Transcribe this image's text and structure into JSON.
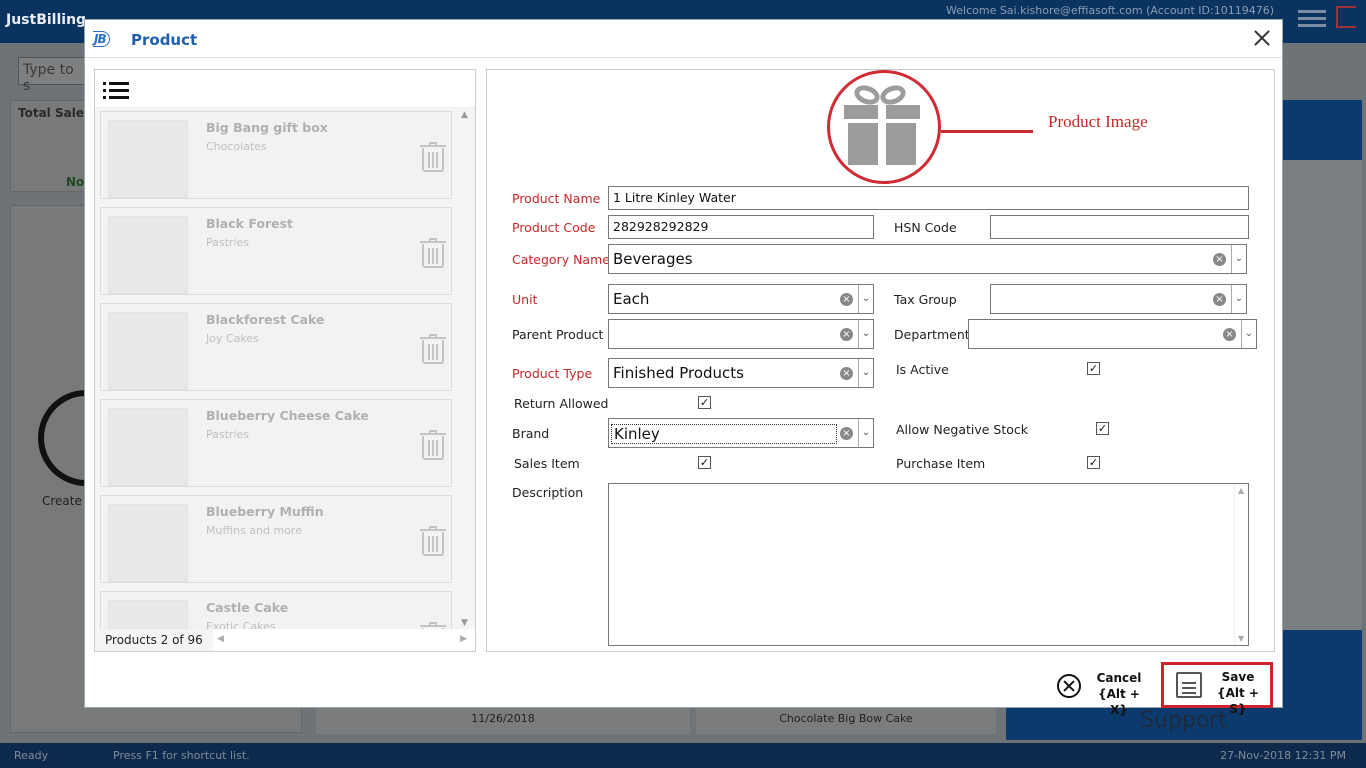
{
  "background": {
    "app_name": "JustBilling",
    "welcome_text": "Welcome Sai.kishore@effiasoft.com (Account ID:10119476)",
    "search_placeholder": "Type to s",
    "total_sales_label": "Total Sales",
    "no_label": "No",
    "create_label": "Create",
    "date_cell": "11/26/2018",
    "product_cell": "Chocolate Big Bow Cake",
    "support_label": "Support",
    "status_ready": "Ready",
    "status_hint": "Press F1 for shortcut list.",
    "status_datetime": "27-Nov-2018 12:31 PM"
  },
  "dialog": {
    "logo": "JB",
    "title": "Product",
    "close_icon": "close-icon"
  },
  "product_list": {
    "items": [
      {
        "name": "Big Bang gift box",
        "category": "Chocolates"
      },
      {
        "name": "Black Forest",
        "category": "Pastries"
      },
      {
        "name": "Blackforest Cake",
        "category": "Joy Cakes"
      },
      {
        "name": "Blueberry Cheese Cake",
        "category": "Pastries"
      },
      {
        "name": "Blueberry Muffin",
        "category": "Muffins and more"
      },
      {
        "name": "Castle Cake",
        "category": "Exotic Cakes"
      }
    ],
    "count_text": "Products 2 of 96"
  },
  "form": {
    "image_label": "Product Image",
    "product_name_label": "Product Name",
    "product_name_value": "1 Litre Kinley Water",
    "product_code_label": "Product Code",
    "product_code_value": "282928292829",
    "hsn_code_label": "HSN Code",
    "hsn_code_value": "",
    "category_name_label": "Category Name",
    "category_name_value": "Beverages",
    "unit_label": "Unit",
    "unit_value": "Each",
    "tax_group_label": "Tax Group",
    "tax_group_value": "",
    "parent_product_label": "Parent Product",
    "parent_product_value": "",
    "department_label": "Department",
    "department_value": "",
    "product_type_label": "Product Type",
    "product_type_value": "Finished Products",
    "is_active_label": "Is Active",
    "is_active": true,
    "return_allowed_label": "Return Allowed",
    "return_allowed": true,
    "brand_label": "Brand",
    "brand_value": "Kinley",
    "allow_negative_stock_label": "Allow Negative Stock",
    "allow_negative_stock": true,
    "sales_item_label": "Sales Item",
    "sales_item": true,
    "purchase_item_label": "Purchase Item",
    "purchase_item": true,
    "description_label": "Description",
    "description_value": ""
  },
  "buttons": {
    "cancel_label": "Cancel",
    "cancel_shortcut": "{Alt + X}",
    "save_label": "Save",
    "save_shortcut": "{Alt + S}"
  },
  "colors": {
    "required_label": "#c62828",
    "highlight_red": "#d0232e",
    "title_blue": "#1f5fae"
  }
}
